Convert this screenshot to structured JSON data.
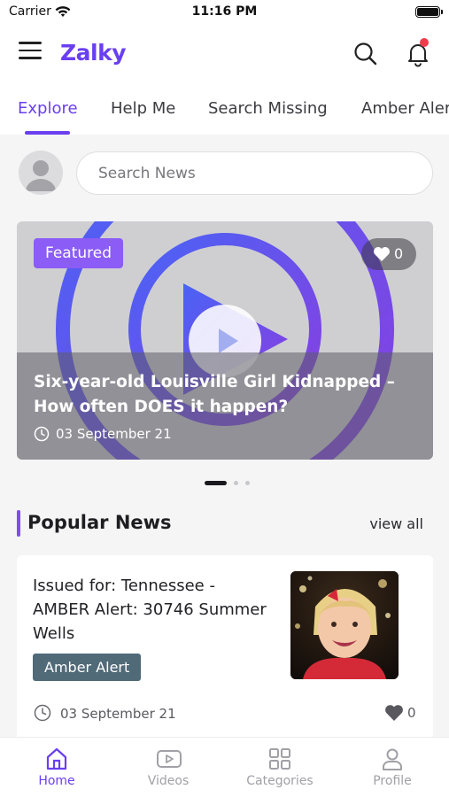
{
  "status_bar": {
    "carrier": "Carrier",
    "time": "11:16 PM"
  },
  "app": {
    "logo": "Zalky",
    "icons": [
      "menu-icon",
      "search-icon",
      "bell-icon"
    ]
  },
  "tabs": [
    {
      "label": "Explore",
      "active": true
    },
    {
      "label": "Help Me",
      "active": false
    },
    {
      "label": "Search Missing",
      "active": false
    },
    {
      "label": "Amber Alert",
      "active": false
    }
  ],
  "search": {
    "placeholder": "Search News",
    "value": ""
  },
  "featured": {
    "badge": "Featured",
    "likes": "0",
    "headline": "Six-year-old Louisville Girl Kidnapped – How often DOES it happen?",
    "date": "03 September 21"
  },
  "carousel": {
    "pages": 3,
    "current": 1
  },
  "popular": {
    "title": "Popular News",
    "view_all": "view all",
    "items": [
      {
        "title": "Issued for: Tennessee - AMBER Alert: 30746 Summer Wells",
        "tag": "Amber Alert",
        "date": "03 September 21",
        "likes": "0"
      }
    ]
  },
  "bottom_nav": [
    {
      "label": "Home",
      "icon": "home-icon",
      "active": true
    },
    {
      "label": "Videos",
      "icon": "video-icon",
      "active": false
    },
    {
      "label": "Categories",
      "icon": "grid-icon",
      "active": false
    },
    {
      "label": "Profile",
      "icon": "person-icon",
      "active": false
    }
  ],
  "colors": {
    "accent": "#6a3ff0",
    "badge": "#8b5cf6",
    "tag": "#506a78",
    "notification": "#ef3b4b"
  }
}
